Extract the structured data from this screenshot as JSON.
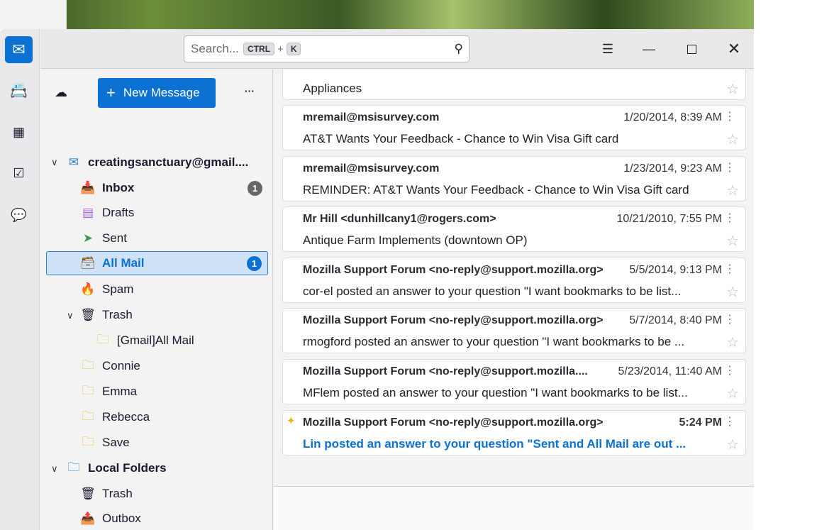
{
  "search": {
    "placeholder": "Search...",
    "key1": "CTRL",
    "plus": "+",
    "key2": "K"
  },
  "toolbar": {
    "new_message": "New Message",
    "more": "···"
  },
  "account": {
    "name": "creatingsanctuary@gmail...."
  },
  "folders": [
    {
      "label": "Inbox",
      "badge": "1"
    },
    {
      "label": "Drafts"
    },
    {
      "label": "Sent"
    },
    {
      "label": "All Mail",
      "badge": "1"
    },
    {
      "label": "Spam"
    },
    {
      "label": "Trash"
    },
    {
      "label": "[Gmail]All Mail"
    },
    {
      "label": "Connie"
    },
    {
      "label": "Emma"
    },
    {
      "label": "Rebecca"
    },
    {
      "label": "Save"
    }
  ],
  "local": {
    "name": "Local Folders",
    "folders": [
      {
        "label": "Trash"
      },
      {
        "label": "Outbox"
      }
    ]
  },
  "messages": [
    {
      "sender": "",
      "date": "",
      "subject": "Appliances"
    },
    {
      "sender": "mremail@msisurvey.com",
      "date": "1/20/2014, 8:39 AM",
      "subject": "AT&T Wants Your Feedback - Chance to Win Visa Gift card"
    },
    {
      "sender": "mremail@msisurvey.com",
      "date": "1/23/2014, 9:23 AM",
      "subject": "REMINDER: AT&T Wants Your Feedback - Chance to Win Visa Gift card"
    },
    {
      "sender": "Mr Hill <dunhillcany1@rogers.com>",
      "date": "10/21/2010, 7:55 PM",
      "subject": "Antique Farm Implements (downtown OP)"
    },
    {
      "sender": "Mozilla Support Forum <no-reply@support.mozilla.org>",
      "date": "5/5/2014, 9:13 PM",
      "subject": "cor-el posted an answer to your question \"I want bookmarks to be list..."
    },
    {
      "sender": "Mozilla Support Forum <no-reply@support.mozilla.org>",
      "date": "5/7/2014, 8:40 PM",
      "subject": "rmogford posted an answer to your question \"I want bookmarks to be ..."
    },
    {
      "sender": "Mozilla Support Forum <no-reply@support.mozilla....",
      "date": "5/23/2014, 11:40 AM",
      "subject": "MFlem posted an answer to your question \"I want bookmarks to be list..."
    },
    {
      "sender": "Mozilla Support Forum <no-reply@support.mozilla.org>",
      "date": "5:24 PM",
      "subject": "Lin posted an answer to your question \"Sent and All Mail are out ..."
    }
  ],
  "colors": {
    "accent": "#0b72d4"
  }
}
